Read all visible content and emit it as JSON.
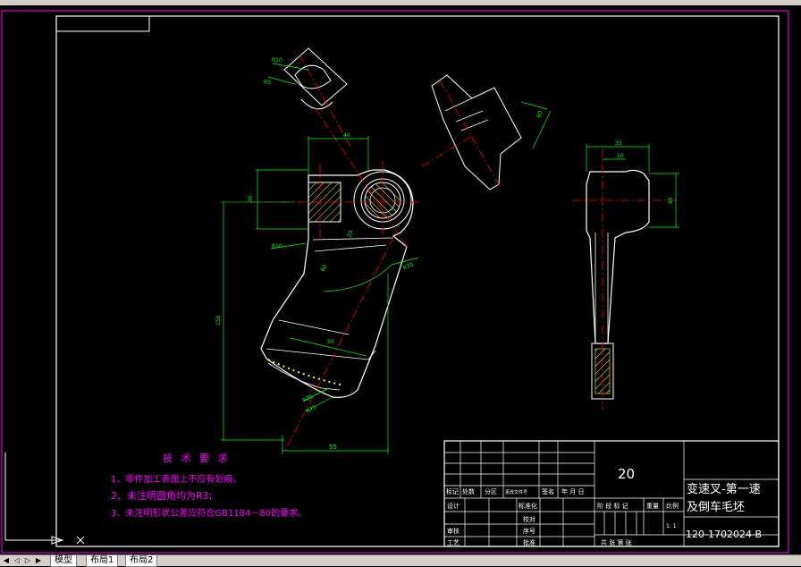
{
  "drawing": {
    "dims": {
      "r10_top": "R10",
      "r5": "R5",
      "d40": "40",
      "d30": "30",
      "r10_left": "R10",
      "d150": "150",
      "d55": "55",
      "r30": "R30",
      "d20": "20",
      "d50": "50",
      "d60": "60",
      "r25": "R25",
      "r75": "R75",
      "d35": "35",
      "d10": "10",
      "d85": "85",
      "d40_side": "40"
    },
    "technical_requirements": {
      "title": "技 术 要 求",
      "items": [
        "1、零件加工表面上不应有划痕。",
        "2、未注明圆角均为R3;",
        "3、未注明形状公差应符合GB1184－80的要求。"
      ]
    }
  },
  "title_block": {
    "material": "20",
    "part_name_line1": "变速叉-第一速",
    "part_name_line2": "及倒车毛坯",
    "drawing_number": "120-1702024-B",
    "labels": {
      "biao_ji": "标记",
      "chu_shu": "处数",
      "fen_qu": "分区",
      "wen_jian": "更改文件号",
      "qian_ming": "签名",
      "nian_yue_ri": "年 月 日",
      "she_ji": "设计",
      "biao_zhun_hua": "标准化",
      "jie_duan": "阶 段 标 记",
      "zhong_liang": "重量",
      "bi_li": "比例",
      "shen_he": "审核",
      "gong_yi": "工艺",
      "pi_zhun": "批准",
      "jiao_dui": "校对",
      "xu_hao": "序号",
      "gong_zhang": "共  张  第  张",
      "scale_value": "1: 1"
    }
  },
  "tabs": {
    "model": "模型",
    "layout1": "布局1",
    "layout2": "布局2"
  },
  "colors": {
    "background": "#000000",
    "geometry": "#ffffff",
    "dimension": "#00ff00",
    "centerline": "#ff0000",
    "hatch": "#ffff00",
    "text": "#ff00ff",
    "border": "#ff00ff"
  }
}
